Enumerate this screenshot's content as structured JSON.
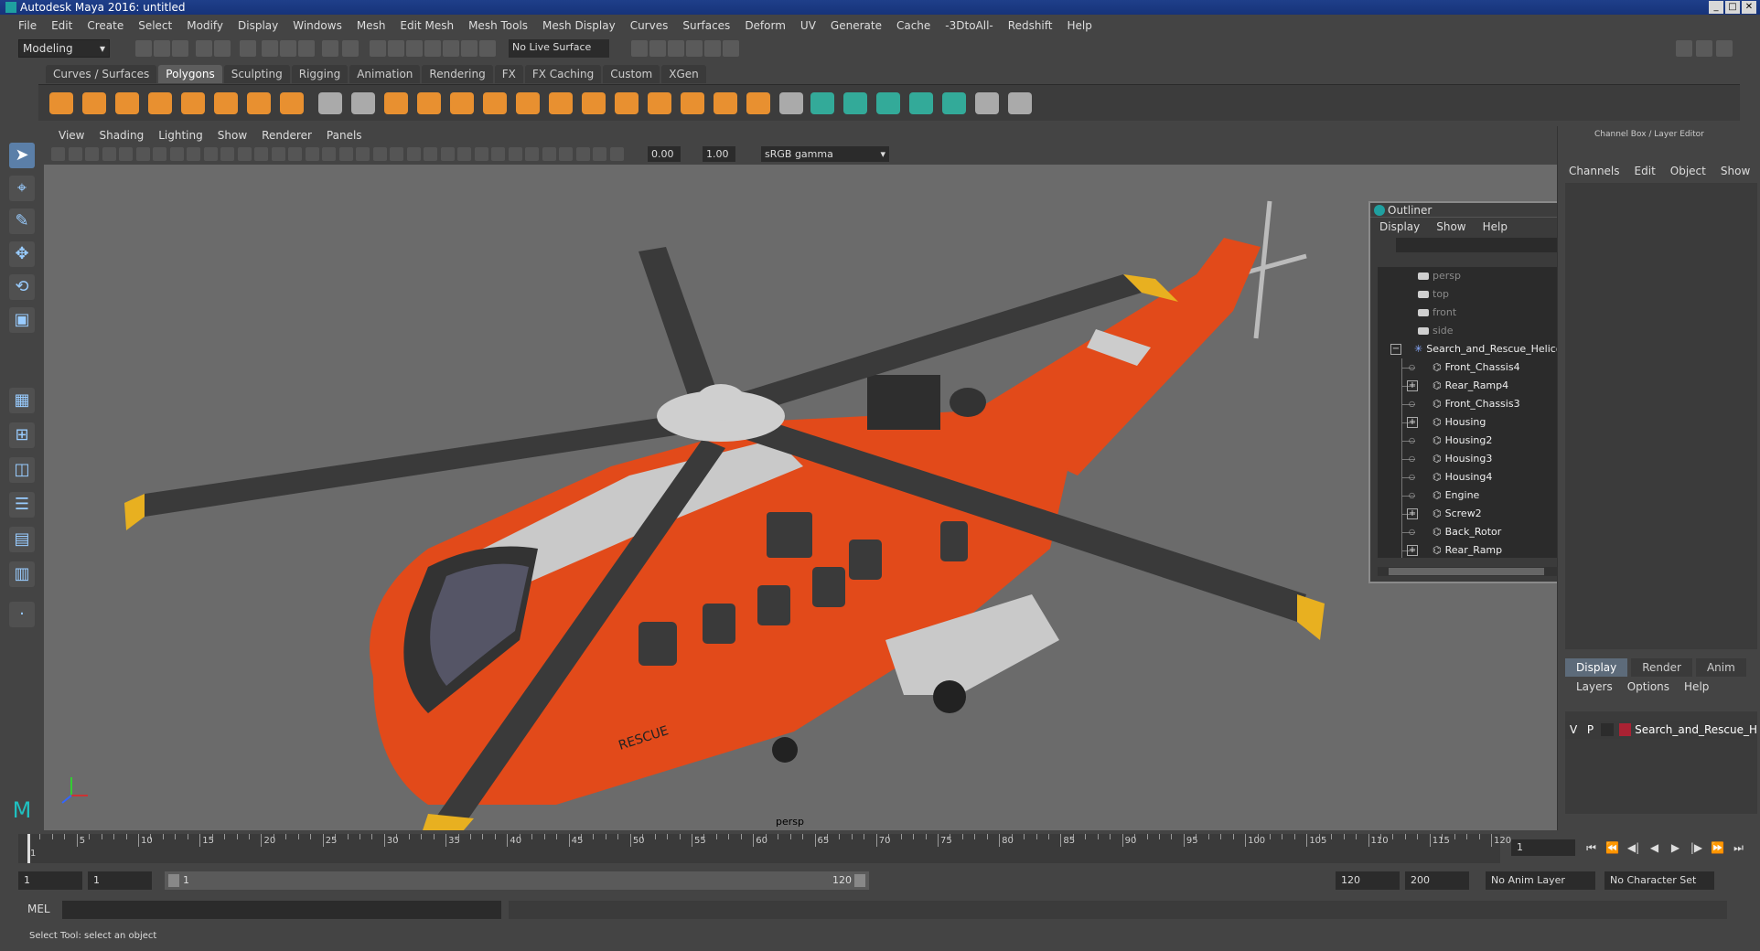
{
  "window": {
    "title": "Autodesk Maya 2016: untitled"
  },
  "menubar": [
    "File",
    "Edit",
    "Create",
    "Select",
    "Modify",
    "Display",
    "Windows",
    "Mesh",
    "Edit Mesh",
    "Mesh Tools",
    "Mesh Display",
    "Curves",
    "Surfaces",
    "Deform",
    "UV",
    "Generate",
    "Cache",
    "-3DtoAll-",
    "Redshift",
    "Help"
  ],
  "toolbar": {
    "mode": "Modeling",
    "live_surface": "No Live Surface"
  },
  "shelf": {
    "tabs": [
      "Curves / Surfaces",
      "Polygons",
      "Sculpting",
      "Rigging",
      "Animation",
      "Rendering",
      "FX",
      "FX Caching",
      "Custom",
      "XGen"
    ],
    "active": "Polygons"
  },
  "panel": {
    "menu": [
      "View",
      "Shading",
      "Lighting",
      "Show",
      "Renderer",
      "Panels"
    ],
    "exposure": "0.00",
    "gamma_value": "1.00",
    "color_space": "sRGB gamma",
    "camera_label": "persp"
  },
  "outliner": {
    "title": "Outliner",
    "menu": [
      "Display",
      "Show",
      "Help"
    ],
    "cameras": [
      "persp",
      "top",
      "front",
      "side"
    ],
    "root": "Search_and_Rescue_Helicopter_n",
    "children": [
      {
        "name": "Front_Chassis4",
        "expandable": false
      },
      {
        "name": "Rear_Ramp4",
        "expandable": true
      },
      {
        "name": "Front_Chassis3",
        "expandable": false
      },
      {
        "name": "Housing",
        "expandable": true
      },
      {
        "name": "Housing2",
        "expandable": false
      },
      {
        "name": "Housing3",
        "expandable": false
      },
      {
        "name": "Housing4",
        "expandable": false
      },
      {
        "name": "Engine",
        "expandable": false
      },
      {
        "name": "Screw2",
        "expandable": true
      },
      {
        "name": "Back_Rotor",
        "expandable": false
      },
      {
        "name": "Rear_Ramp",
        "expandable": true
      }
    ]
  },
  "channelbox": {
    "title": "Channel Box / Layer Editor",
    "menu": [
      "Channels",
      "Edit",
      "Object",
      "Show"
    ],
    "tabs": [
      "Display",
      "Render",
      "Anim"
    ],
    "active_tab": "Display",
    "layer_menu": [
      "Layers",
      "Options",
      "Help"
    ],
    "layer": {
      "v": "V",
      "p": "P",
      "name": "Search_and_Rescue_H"
    }
  },
  "timeline": {
    "ticks": [
      1,
      5,
      10,
      15,
      20,
      25,
      30,
      35,
      40,
      45,
      50,
      55,
      60,
      65,
      70,
      75,
      80,
      85,
      90,
      95,
      100,
      105,
      110,
      115,
      120
    ],
    "min": 1,
    "max": 120,
    "current_frame": "1"
  },
  "range": {
    "start": "1",
    "start2": "1",
    "slider_start": "1",
    "slider_end": "120",
    "end": "120",
    "end2": "200",
    "anim_layer": "No Anim Layer",
    "character_set": "No Character Set"
  },
  "cmdline": {
    "label": "MEL"
  },
  "status": {
    "text": "Select Tool: select an object"
  },
  "colors": {
    "helicopter": "#e24a1a",
    "viewport_bg": "#6b6b6b",
    "rotor": "#3a3a3a",
    "blade_tip": "#e8b020"
  }
}
